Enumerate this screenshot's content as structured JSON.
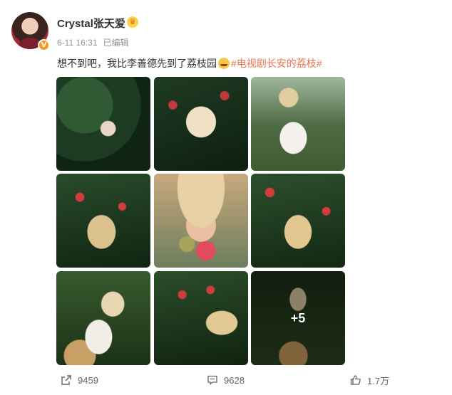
{
  "post": {
    "author": "Crystal张天爱",
    "time": "6-11 16:31",
    "edited": "已编辑",
    "text": "想不到吧，我比李善德先到了荔枝园",
    "hashtag": "#电视剧长安的荔枝#",
    "more_photos": "+5"
  },
  "icons": {
    "avatar": "avatar",
    "verified": "verified-v-icon",
    "vip": "vip-crown-icon",
    "emoji": "smirk-emoji-icon",
    "share": "share-icon",
    "comment": "comment-icon",
    "like": "thumbs-up-icon"
  },
  "stats": {
    "shares": "9459",
    "comments": "9628",
    "likes": "1.7万"
  },
  "colors": {
    "hashtag": "#eb7350",
    "verified": "#f59b1a",
    "meta": "#939393"
  }
}
